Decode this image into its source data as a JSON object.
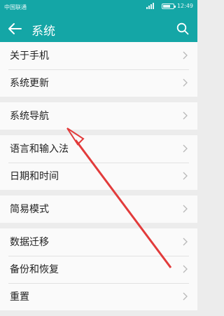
{
  "status": {
    "carrier": "中国联通",
    "time": "12:49",
    "battery_level": 0.75
  },
  "appbar": {
    "title": "系统",
    "back_icon": "arrow-left-icon",
    "search_icon": "search-icon"
  },
  "groups": [
    [
      "关于手机",
      "系统更新"
    ],
    [
      "系统导航"
    ],
    [
      "语言和输入法",
      "日期和时间"
    ],
    [
      "简易模式"
    ],
    [
      "数据迁移",
      "备份和恢复",
      "重置"
    ]
  ],
  "annotation": {
    "type": "red-arrow",
    "color": "#e23b3b",
    "points_to": "语言和输入法"
  }
}
